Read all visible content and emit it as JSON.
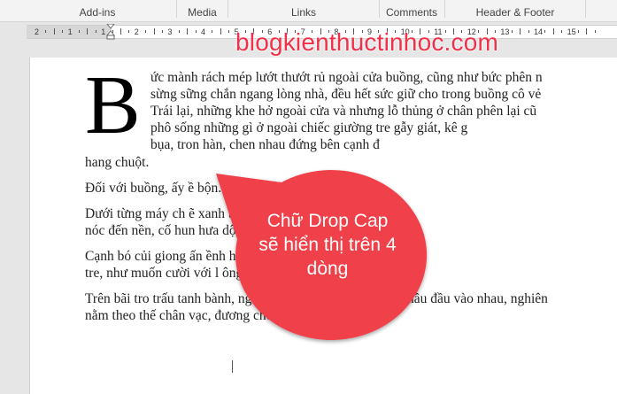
{
  "ribbon": {
    "groups": [
      "Add-ins",
      "Media",
      "Links",
      "Comments",
      "Header & Footer"
    ]
  },
  "ruler": {
    "numbers": [
      "2",
      "1",
      "1",
      "2",
      "3",
      "4",
      "5",
      "6",
      "7",
      "8",
      "9",
      "10",
      "11",
      "12",
      "13",
      "14",
      "15"
    ]
  },
  "watermark": "blogkienthuctinhoc.com",
  "doc": {
    "drop_cap": "B",
    "first_lines": [
      "ức mành rách mép lướt thướt rủ ngoài cửa buồng, cũng như bức phên n",
      "sừng sững chắn ngang lòng nhà, đều hết sức giữ cho trong buồng cô vẻ",
      "Trái lại, những khe hở ngoài cửa và nhưng lỗ thủng ở chân phên lại cũ",
      "phô sống những gì ở ngoài chiếc giường tre gẫy giát, kê g",
      "bụa, tron                 hàn, chen nhau đứng bên cạnh đ"
    ],
    "paragraphs": [
      [
        "hang chuột."
      ],
      [
        "Đối với buồng, ấy                                        ề bộn."
      ],
      [
        "Dưới từng máy ch                                         ẽ xanh tía, thông thống kéo t",
        "nóc đến nền, cố hun                                     hưa dột."
      ],
      [
        "Cạnh bó củi giong ấn                                    ềnh hệch nằm ngửa trong nhữn",
        "tre, như muốn cười với l                          ông lốc lăn nghiêng lăn ngửa."
      ],
      [
        "Trên bãi tro trấu tanh bành, nguội lạnh, mấy hòn gạch vỡ chầu đầu vào nhau, nghiên",
        "nằm theo thế chân vạc, đương chờ đến lúc đội nồi."
      ]
    ]
  },
  "callout": {
    "text": "Chữ Drop Cap sẽ hiển thị trên 4 dòng",
    "color": "#f04048"
  }
}
